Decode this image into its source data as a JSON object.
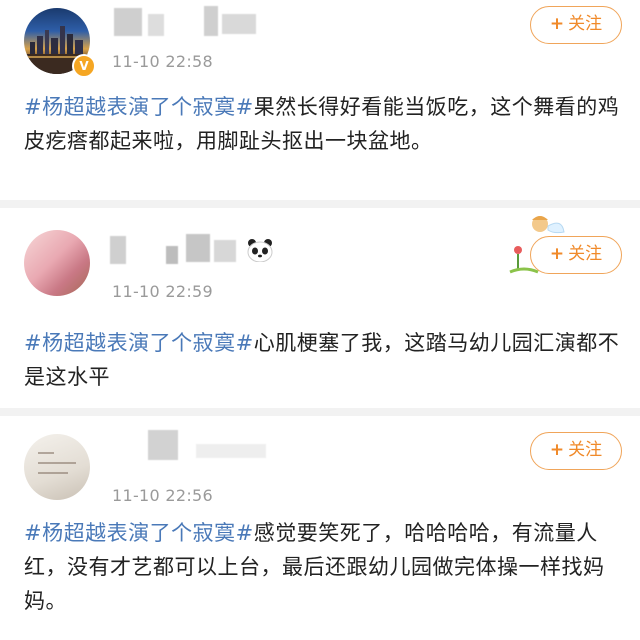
{
  "posts": [
    {
      "timestamp": "11-10 22:58",
      "follow_label": "关注",
      "hashtag": "#杨超越表演了个寂寞#",
      "text": "果然长得好看能当饭吃，这个舞看的鸡皮疙瘩都起来啦，用脚趾头抠出一块盆地。"
    },
    {
      "timestamp": "11-10 22:59",
      "follow_label": "关注",
      "hashtag": "#杨超越表演了个寂寞#",
      "text": "心肌梗塞了我，这踏马幼儿园汇演都不是这水平"
    },
    {
      "timestamp": "11-10 22:56",
      "follow_label": "关注",
      "hashtag": "#杨超越表演了个寂寞#",
      "text": "感觉要笑死了，哈哈哈哈，有流量人红，没有才艺都可以上台，最后还跟幼儿园做完体操一样找妈妈。"
    }
  ],
  "icons": {
    "follow": "plus-icon",
    "verified": "verified-badge-icon",
    "emoji": "panda-icon",
    "decoration": "mascot-icon"
  },
  "colors": {
    "hashtag": "#4a79b8",
    "follow": "#f08a2a",
    "timestamp": "#9a9a9a",
    "text": "#222222"
  }
}
